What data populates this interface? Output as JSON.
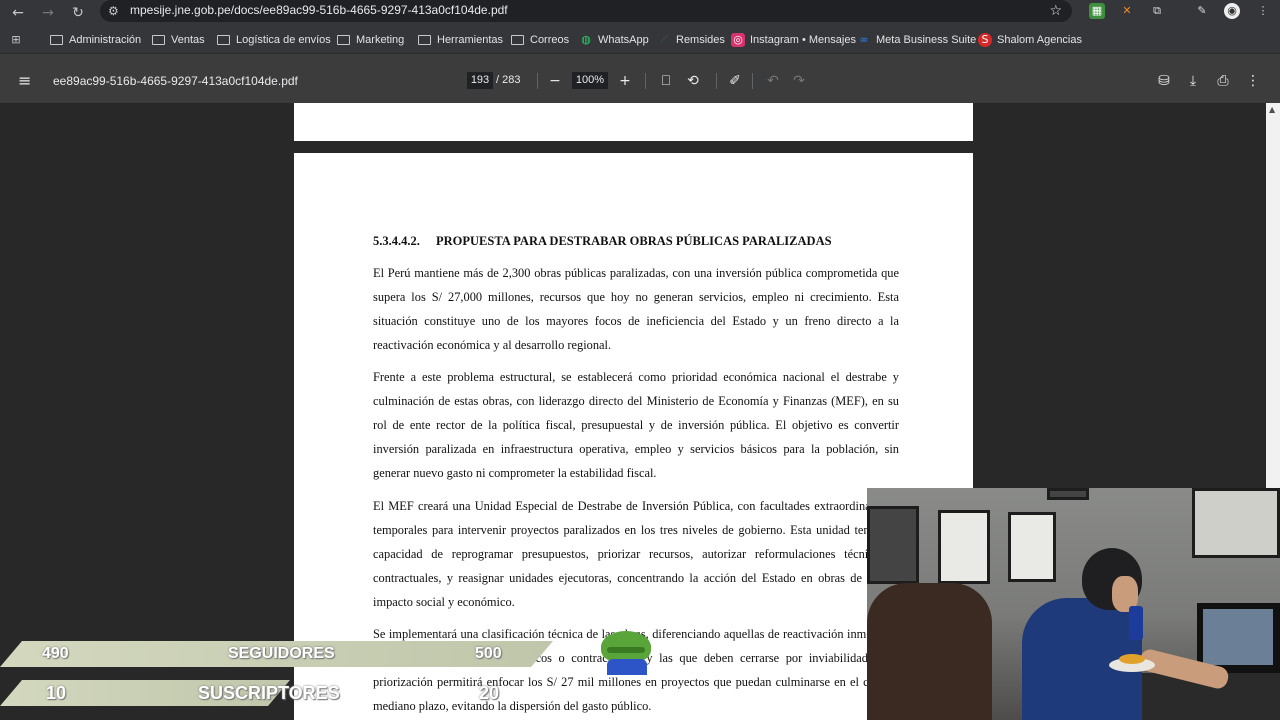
{
  "browser": {
    "url": "mpesije.jne.gob.pe/docs/ee89ac99-516b-4665-9297-413a0cf104de.pdf",
    "bookmarks": [
      {
        "label": "Administración",
        "icon": "folder-icon"
      },
      {
        "label": "Ventas",
        "icon": "folder-icon"
      },
      {
        "label": "Logística de envíos",
        "icon": "folder-icon"
      },
      {
        "label": "Marketing",
        "icon": "folder-icon"
      },
      {
        "label": "Herramientas",
        "icon": "folder-icon"
      },
      {
        "label": "Correos",
        "icon": "folder-icon"
      },
      {
        "label": "WhatsApp",
        "icon": "whatsapp-icon"
      },
      {
        "label": "Remsides",
        "icon": "remsides-icon"
      },
      {
        "label": "Instagram • Mensajes",
        "icon": "instagram-icon"
      },
      {
        "label": "Meta Business Suite",
        "icon": "meta-icon"
      },
      {
        "label": "Shalom Agencias",
        "icon": "shalom-icon"
      }
    ]
  },
  "pdf_toolbar": {
    "filename": "ee89ac99-516b-4665-9297-413a0cf104de.pdf",
    "current_page": "193",
    "total_pages": "/ 283",
    "zoom": "100%"
  },
  "document": {
    "heading_number": "5.3.4.4.2.",
    "heading_title": "PROPUESTA PARA DESTRABAR OBRAS PÚBLICAS PARALIZADAS",
    "paragraphs": [
      "El Perú mantiene más de 2,300 obras públicas paralizadas, con una inversión pública comprometida que supera los S/ 27,000 millones, recursos que hoy no generan servicios, empleo ni crecimiento. Esta situación constituye uno de los mayores focos de ineficiencia del Estado y un freno directo a la reactivación económica y al desarrollo regional.",
      "Frente a este problema estructural, se establecerá como prioridad económica nacional el destrabe y culminación de estas obras, con liderazgo directo del Ministerio de Economía y Finanzas (MEF), en su rol de ente rector de la política fiscal, presupuestal y de inversión pública. El objetivo es convertir inversión paralizada en infraestructura operativa, empleo y servicios básicos para la población, sin generar nuevo gasto ni comprometer la estabilidad fiscal.",
      "El MEF creará una Unidad Especial de Destrabe de Inversión Pública, con facultades extraordinarias y temporales para intervenir proyectos paralizados en los tres niveles de gobierno. Esta unidad tendrá la capacidad de reprogramar presupuestos, priorizar recursos, autorizar reformulaciones técnicas y contractuales, y reasignar unidades ejecutoras, concentrando la acción del Estado en obras de mayor impacto social y económico.",
      "Se implementará una clasificación técnica de las obras, diferenciando aquellas de reactivación inmediata, las que requieren ajustes técnicos o contractuales, y las que deben cerrarse por inviabilidad. Esta priorización permitirá enfocar los S/ 27 mil millones en proyectos que puedan culminarse en el corto y mediano plazo, evitando la dispersión del gasto público."
    ]
  },
  "stream_overlay": {
    "followers_current": "490",
    "followers_label": "SEGUIDORES",
    "followers_goal": "500",
    "subscribers_current": "10",
    "subscribers_label": "SUSCRIPTORES",
    "subscribers_goal": "20"
  }
}
